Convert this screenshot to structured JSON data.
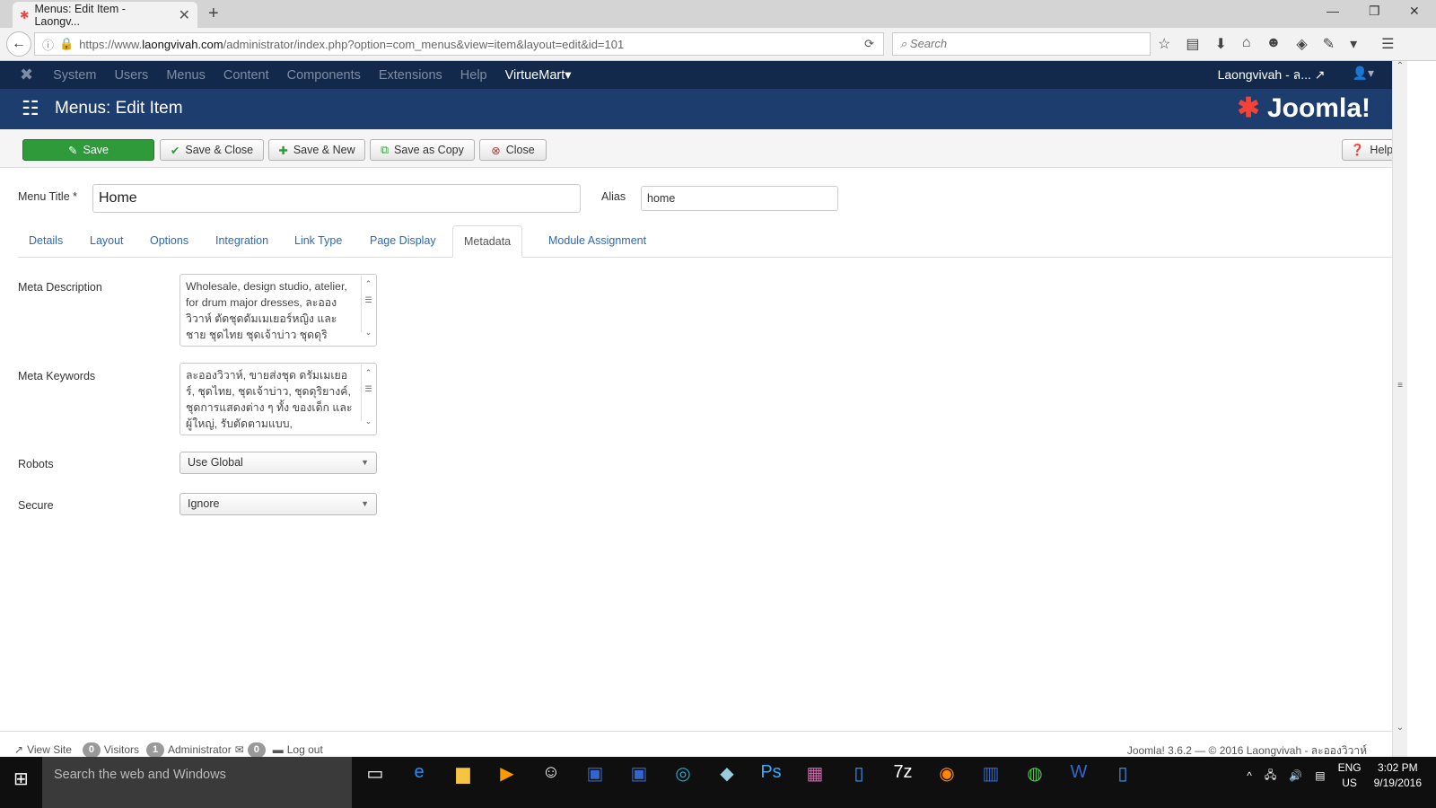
{
  "browser": {
    "tab_title": "Menus: Edit Item - Laongv...",
    "url_host_prefix": "https://www.",
    "url_host": "laongvivah.com",
    "url_path": "/administrator/index.php?option=com_menus&view=item&layout=edit&id=101",
    "search_placeholder": "Search"
  },
  "topnav": {
    "items": [
      "System",
      "Users",
      "Menus",
      "Content",
      "Components",
      "Extensions",
      "Help"
    ],
    "virtuemart": "VirtueMart",
    "site": "Laongvivah - ล...",
    "user_icon": "user-icon"
  },
  "header": {
    "title": "Menus: Edit Item",
    "logo": "Joomla!"
  },
  "toolbar": {
    "save": "Save",
    "save_close": "Save & Close",
    "save_new": "Save & New",
    "save_copy": "Save as Copy",
    "close": "Close",
    "help": "Help"
  },
  "form": {
    "title_label": "Menu Title *",
    "title_value": "Home",
    "alias_label": "Alias",
    "alias_value": "home"
  },
  "tabs": [
    "Details",
    "Layout",
    "Options",
    "Integration",
    "Link Type",
    "Page Display",
    "Metadata",
    "Module Assignment"
  ],
  "metadata": {
    "desc_label": "Meta Description",
    "desc_value": "Wholesale, design studio, atelier, for drum major dresses, ละอองวิวาห์ ตัดชุดดัมเมเยอร์หญิง และชาย ชุดไทย ชุดเจ้าบ่าว ชุดดุริ",
    "kw_label": "Meta Keywords",
    "kw_value": "ละอองวิวาห์, ขายส่งชุด ดรัมเมเยอร์, ชุดไทย, ชุดเจ้าบ่าว, ชุดดุริยางค์, ชุดการแสดงต่าง ๆ ทั้ง ของเด็ก และผู้ใหญ่, รับตัดตามแบบ,",
    "robots_label": "Robots",
    "robots_value": "Use Global",
    "secure_label": "Secure",
    "secure_value": "Ignore"
  },
  "status": {
    "view_site": "View Site",
    "visitors_count": "0",
    "visitors": "Visitors",
    "admin_count": "1",
    "admin": "Administrator",
    "messages_count": "0",
    "logout": "Log out",
    "copyright": "Joomla! 3.6.2 — © 2016 Laongvivah - ละอองวิวาห์"
  },
  "taskbar": {
    "search": "Search the web and Windows",
    "lang1": "ENG",
    "lang2": "US",
    "time": "3:02 PM",
    "date": "9/19/2016"
  }
}
